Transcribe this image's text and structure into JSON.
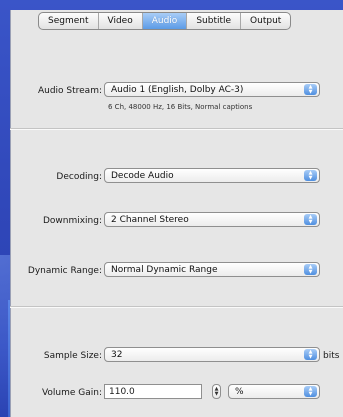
{
  "tabs": [
    "Segment",
    "Video",
    "Audio",
    "Subtitle",
    "Output"
  ],
  "active_tab": "Audio",
  "audio_stream": {
    "label": "Audio Stream:",
    "value": "Audio 1 (English, Dolby AC-3)",
    "info": "6 Ch, 48000 Hz, 16 Bits, Normal captions"
  },
  "decoding": {
    "label": "Decoding:",
    "value": "Decode Audio"
  },
  "downmixing": {
    "label": "Downmixing:",
    "value": "2 Channel Stereo"
  },
  "dynamic_range": {
    "label": "Dynamic Range:",
    "value": "Normal Dynamic Range"
  },
  "sample_size": {
    "label": "Sample Size:",
    "value": "32",
    "unit": "bits"
  },
  "volume_gain": {
    "label": "Volume Gain:",
    "value": "110.0",
    "unit_value": "%"
  },
  "icons": {
    "popup_arrows": "up-down-arrows-icon",
    "stepper": "stepper-icon"
  },
  "colors": {
    "accent": "#5c9be6",
    "panel": "#e6e6e6",
    "background": "#2f46b8"
  }
}
